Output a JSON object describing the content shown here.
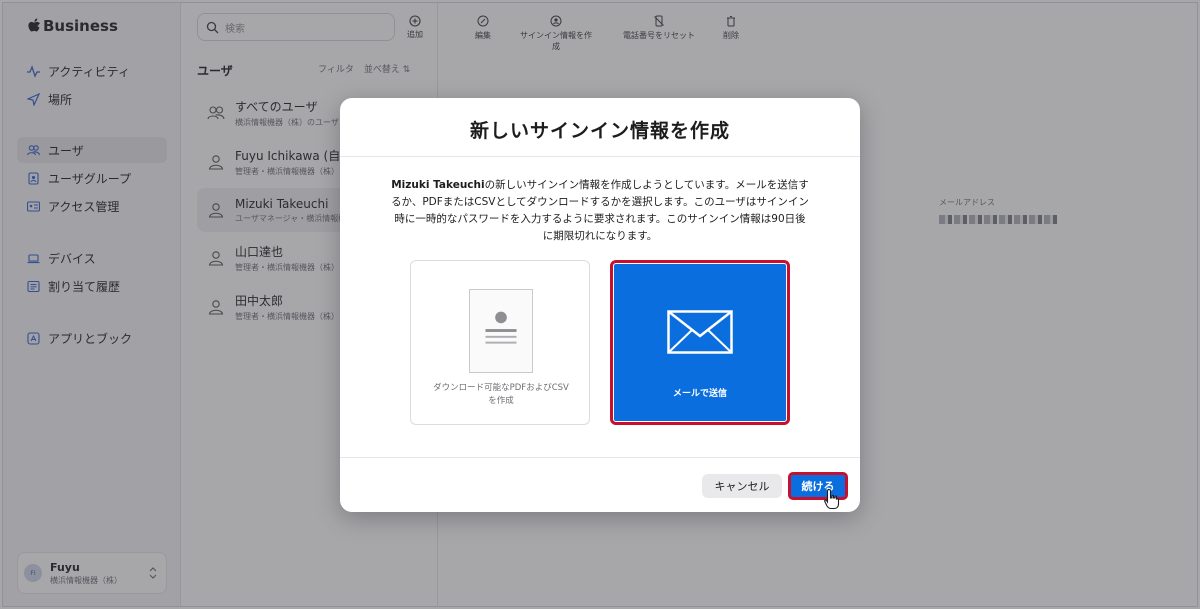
{
  "brand": {
    "name": "Business"
  },
  "sidebar": {
    "items": [
      {
        "label": "アクティビティ",
        "icon": "activity-icon"
      },
      {
        "label": "場所",
        "icon": "location-arrow-icon"
      },
      {
        "label": "ユーザ",
        "icon": "users-icon",
        "active": true
      },
      {
        "label": "ユーザグループ",
        "icon": "user-group-icon"
      },
      {
        "label": "アクセス管理",
        "icon": "id-card-icon"
      },
      {
        "label": "デバイス",
        "icon": "laptop-icon"
      },
      {
        "label": "割り当て履歴",
        "icon": "history-list-icon"
      },
      {
        "label": "アプリとブック",
        "icon": "app-store-icon"
      }
    ],
    "account": {
      "initials": "FI",
      "name": "Fuyu",
      "org": "横浜情報機器（株）"
    }
  },
  "users_panel": {
    "search_placeholder": "検索",
    "add_label": "追加",
    "title": "ユーザ",
    "filter_label": "フィルタ",
    "sort_label": "並べ替え ⇅",
    "rows": [
      {
        "name": "すべてのユーザ",
        "role": "横浜情報機器（株）のユーザ"
      },
      {
        "name": "Fuyu Ichikawa (自分)",
        "role": "管理者・横浜情報機器（株）"
      },
      {
        "name": "Mizuki Takeuchi",
        "role": "ユーザマネージャ・横浜情報機"
      },
      {
        "name": "山口達也",
        "role": "管理者・横浜情報機器（株）"
      },
      {
        "name": "田中太郎",
        "role": "管理者・横浜情報機器（株）"
      }
    ]
  },
  "toolbar": {
    "edit": "編集",
    "create_signin": "サインイン情報を作成",
    "reset_phone": "電話番号をリセット",
    "delete": "削除"
  },
  "detail": {
    "email_label": "メールアドレス"
  },
  "modal": {
    "title": "新しいサインイン情報を作成",
    "desc_name": "Mizuki Takeuchi",
    "desc_text": "の新しいサインイン情報を作成しようとしています。メールを送信するか、PDFまたはCSVとしてダウンロードするかを選択します。このユーザはサインイン時に一時的なパスワードを入力するように要求されます。このサインイン情報は90日後に期限切れになります。",
    "option_pdf": "ダウンロード可能なPDFおよびCSVを作成",
    "option_mail": "メールで送信",
    "cancel": "キャンセル",
    "continue": "続ける"
  },
  "colors": {
    "accent": "#0b6ede",
    "highlight": "#c8102e"
  }
}
